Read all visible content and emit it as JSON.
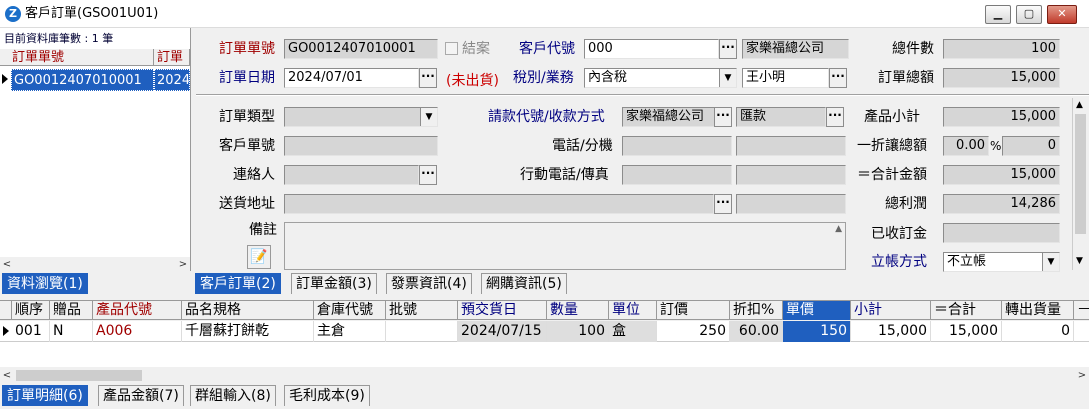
{
  "window": {
    "title": "客戶訂單(GSO01U01)",
    "app_icon": "Z"
  },
  "left_panel": {
    "record_count": "目前資料庫筆數 : 1 筆",
    "columns": [
      "訂單單號",
      "訂單"
    ],
    "rows": [
      [
        "GO0012407010001",
        "2024"
      ]
    ]
  },
  "header": {
    "order_no_label": "訂單單號",
    "order_no": "GO0012407010001",
    "closed_label": "結案",
    "customer_code_label": "客戶代號",
    "customer_code": "000",
    "customer_name": "家樂福總公司",
    "order_date_label": "訂單日期",
    "order_date": "2024/07/01",
    "ship_status": "(未出貨)",
    "tax_label": "稅別/業務",
    "tax_type": "內含稅",
    "salesperson": "王小明",
    "total_count_label": "總件數",
    "total_count": "100",
    "order_total_label": "訂單總額",
    "order_total": "15,000"
  },
  "detail": {
    "order_type_label": "訂單類型",
    "order_type": "",
    "billing_label": "請款代號/收款方式",
    "billing_code": "家樂福總公司",
    "payment_method": "匯款",
    "cust_order_label": "客戶單號",
    "phone_label": "電話/分機",
    "contact_label": "連絡人",
    "mobile_label": "行動電話/傳真",
    "address_label": "送貨地址",
    "notes_label": "備註",
    "product_subtotal_label": "產品小計",
    "product_subtotal": "15,000",
    "discount_label": "一折讓總額",
    "discount_pct": "0.00",
    "pct_sign": "%",
    "discount_amount": "0",
    "grand_total_label": "＝合計金額",
    "grand_total": "15,000",
    "gross_profit_label": "總利潤",
    "gross_profit": "14,286",
    "deposit_label": "已收訂金",
    "deposit": "",
    "account_label": "立帳方式",
    "account_method": "不立帳"
  },
  "tabs_top": {
    "browse": "資料瀏覽(1)",
    "items": [
      "客戶訂單(2)",
      "訂單金額(3)",
      "發票資訊(4)",
      "網購資訊(5)"
    ]
  },
  "grid": {
    "columns": [
      "順序",
      "贈品",
      "產品代號",
      "品名規格",
      "倉庫代號",
      "批號",
      "預交貨日",
      "數量",
      "單位",
      "訂價",
      "折扣%",
      "單價",
      "小計",
      "＝合計",
      "轉出貨量",
      "－"
    ],
    "rows": [
      [
        "001",
        "N",
        "A006",
        "千層蘇打餅乾",
        "主倉",
        "",
        "2024/07/15",
        "100",
        "盒",
        "250",
        "60.00",
        "150",
        "15,000",
        "15,000",
        "0",
        ""
      ]
    ]
  },
  "tabs_bottom": [
    "訂單明細(6)",
    "產品金額(7)",
    "群組輸入(8)",
    "毛利成本(9)"
  ],
  "colors": {
    "accent": "#1f5fbf",
    "label_blue": "#000080",
    "label_red": "#a00000",
    "status_red": "#cc0000"
  }
}
